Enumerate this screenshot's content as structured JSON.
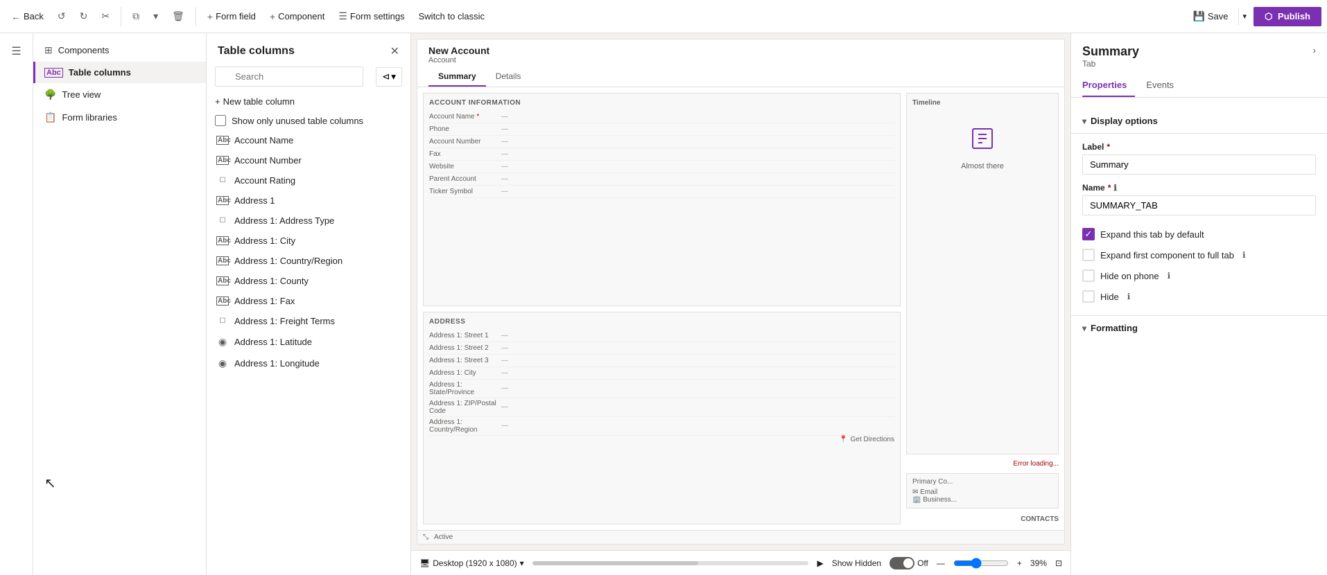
{
  "toolbar": {
    "back_label": "Back",
    "form_field_label": "Form field",
    "component_label": "Component",
    "form_settings_label": "Form settings",
    "switch_classic_label": "Switch to classic",
    "save_label": "Save",
    "publish_label": "Publish"
  },
  "left_nav": {
    "items": [
      {
        "id": "components",
        "label": "Components",
        "icon": "⊞"
      },
      {
        "id": "table-columns",
        "label": "Table columns",
        "icon": "Abc",
        "active": true
      },
      {
        "id": "tree-view",
        "label": "Tree view",
        "icon": "🌲"
      },
      {
        "id": "form-libraries",
        "label": "Form libraries",
        "icon": "📚"
      }
    ]
  },
  "table_columns": {
    "title": "Table columns",
    "search_placeholder": "Search",
    "new_column_label": "New table column",
    "show_unused_label": "Show only unused table columns",
    "items": [
      {
        "name": "Account Name",
        "icon": "Abc"
      },
      {
        "name": "Account Number",
        "icon": "Abc"
      },
      {
        "name": "Account Rating",
        "icon": "☐"
      },
      {
        "name": "Address 1",
        "icon": "Abc"
      },
      {
        "name": "Address 1: Address Type",
        "icon": "☐"
      },
      {
        "name": "Address 1: City",
        "icon": "Abc"
      },
      {
        "name": "Address 1: Country/Region",
        "icon": "Abc"
      },
      {
        "name": "Address 1: County",
        "icon": "Abc"
      },
      {
        "name": "Address 1: Fax",
        "icon": "Abc"
      },
      {
        "name": "Address 1: Freight Terms",
        "icon": "☐"
      },
      {
        "name": "Address 1: Latitude",
        "icon": "◉"
      },
      {
        "name": "Address 1: Longitude",
        "icon": "◉"
      }
    ]
  },
  "form_preview": {
    "title": "New Account",
    "subtitle": "Account",
    "tabs": [
      {
        "label": "Summary",
        "active": true
      },
      {
        "label": "Details",
        "active": false
      }
    ],
    "account_info_title": "ACCOUNT INFORMATION",
    "fields": [
      {
        "label": "Account Name",
        "value": "—"
      },
      {
        "label": "Phone",
        "value": "—"
      },
      {
        "label": "Account Number",
        "value": "—"
      },
      {
        "label": "Fax",
        "value": "—"
      },
      {
        "label": "Website",
        "value": "—"
      },
      {
        "label": "Parent Account",
        "value": "—"
      },
      {
        "label": "Ticker Symbol",
        "value": "—"
      }
    ],
    "timeline_title": "Timeline",
    "almost_there_text": "Almost there",
    "error_loading": "Error loading...",
    "address_title": "ADDRESS",
    "address_fields": [
      {
        "label": "Address 1: Street 1",
        "value": "—"
      },
      {
        "label": "Address 1: Street 2",
        "value": "—"
      },
      {
        "label": "Address 1: Street 3",
        "value": "—"
      },
      {
        "label": "Address 1: City",
        "value": "—"
      },
      {
        "label": "Address 1: State/Province",
        "value": "—"
      },
      {
        "label": "Address 1: ZIP/Postal Code",
        "value": "—"
      },
      {
        "label": "Address 1: Country/Region",
        "value": "—"
      }
    ],
    "get_directions": "Get Directions",
    "contacts_label": "CONTACTS",
    "status_label": "Active"
  },
  "status_bar": {
    "desktop_label": "Desktop (1920 x 1080)",
    "show_hidden_label": "Show Hidden",
    "toggle_state": "Off",
    "zoom_label": "39%"
  },
  "right_panel": {
    "title": "Summary",
    "subtitle": "Tab",
    "tabs": [
      {
        "label": "Properties",
        "active": true
      },
      {
        "label": "Events",
        "active": false
      }
    ],
    "display_options_label": "Display options",
    "label_field": {
      "label": "Label",
      "required": true,
      "value": "Summary"
    },
    "name_field": {
      "label": "Name",
      "required": true,
      "value": "SUMMARY_TAB"
    },
    "expand_tab_label": "Expand this tab by default",
    "expand_tab_checked": true,
    "expand_full_label": "Expand first component to full tab",
    "expand_full_checked": false,
    "hide_phone_label": "Hide on phone",
    "hide_phone_checked": false,
    "hide_label": "Hide",
    "hide_checked": false,
    "formatting_label": "Formatting"
  }
}
